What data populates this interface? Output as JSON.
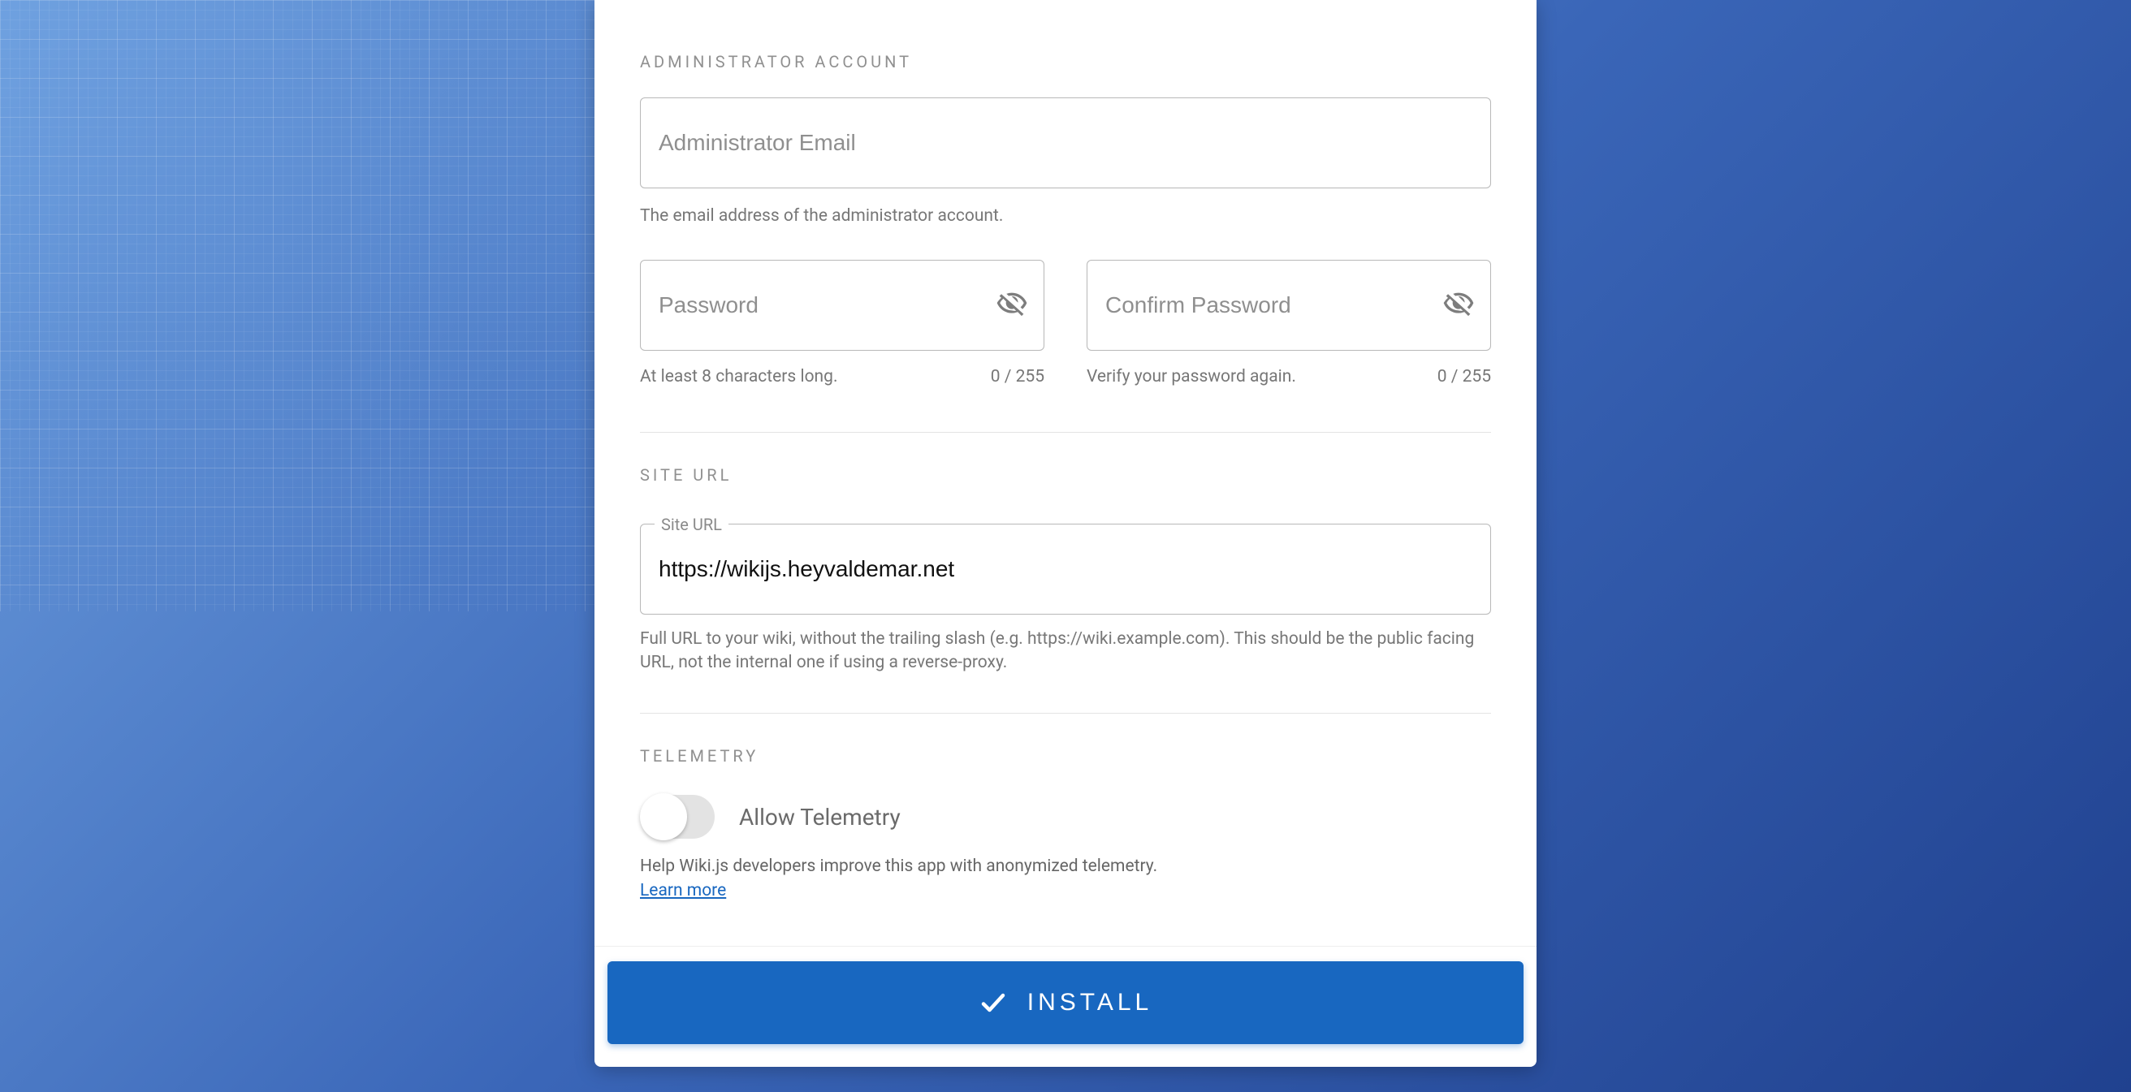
{
  "sections": {
    "admin": {
      "title": "ADMINISTRATOR ACCOUNT",
      "email": {
        "placeholder": "Administrator Email",
        "value": "",
        "hint": "The email address of the administrator account."
      },
      "password": {
        "placeholder": "Password",
        "hint": "At least 8 characters long.",
        "counter": "0 / 255"
      },
      "confirm": {
        "placeholder": "Confirm Password",
        "hint": "Verify your password again.",
        "counter": "0 / 255"
      }
    },
    "siteurl": {
      "title": "SITE URL",
      "float_label": "Site URL",
      "value": "https://wikijs.heyvaldemar.net",
      "hint": "Full URL to your wiki, without the trailing slash (e.g. https://wiki.example.com). This should be the public facing URL, not the internal one if using a reverse-proxy."
    },
    "telemetry": {
      "title": "TELEMETRY",
      "toggle_label": "Allow Telemetry",
      "enabled": false,
      "hint": "Help Wiki.js developers improve this app with anonymized telemetry.",
      "learn_more": "Learn more"
    }
  },
  "install_button": "INSTALL"
}
